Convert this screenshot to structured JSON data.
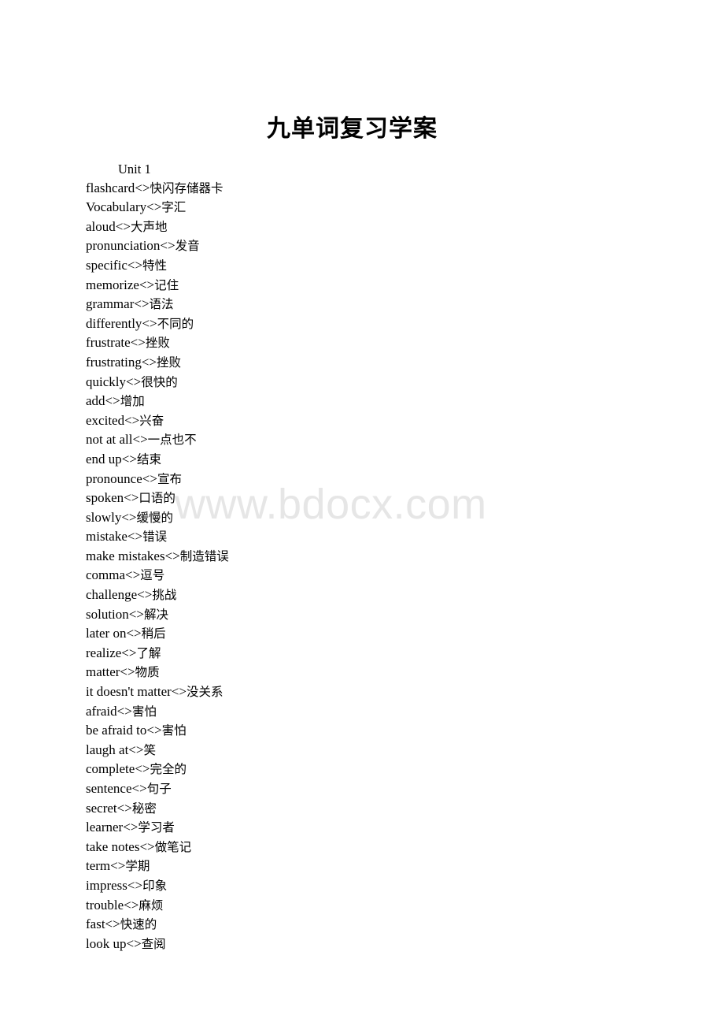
{
  "document": {
    "title": "九单词复习学案",
    "separator": "<>",
    "watermark": "www.bdocx.com",
    "watermark_color": "#e6e6e6",
    "text_color": "#000000",
    "page_background": "#ffffff"
  },
  "sections": [
    {
      "heading": "Unit 1",
      "entries": [
        {
          "term": "flashcard",
          "meaning": "快闪存储器卡"
        },
        {
          "term": "Vocabulary",
          "meaning": "字汇"
        },
        {
          "term": "aloud",
          "meaning": "大声地"
        },
        {
          "term": "pronunciation",
          "meaning": "发音"
        },
        {
          "term": "specific",
          "meaning": "特性"
        },
        {
          "term": "memorize",
          "meaning": "记住"
        },
        {
          "term": "grammar",
          "meaning": "语法"
        },
        {
          "term": "differently",
          "meaning": "不同的"
        },
        {
          "term": "frustrate",
          "meaning": "挫败"
        },
        {
          "term": "frustrating",
          "meaning": "挫败"
        },
        {
          "term": "quickly",
          "meaning": "很快的"
        },
        {
          "term": "add",
          "meaning": "增加"
        },
        {
          "term": "excited",
          "meaning": "兴奋"
        },
        {
          "term": "not at all",
          "meaning": "一点也不"
        },
        {
          "term": "end up",
          "meaning": "结束"
        },
        {
          "term": "pronounce",
          "meaning": "宣布"
        },
        {
          "term": "spoken",
          "meaning": "口语的"
        },
        {
          "term": "slowly",
          "meaning": "缓慢的"
        },
        {
          "term": "mistake",
          "meaning": "错误"
        },
        {
          "term": "make mistakes",
          "meaning": "制造错误"
        },
        {
          "term": "comma",
          "meaning": "逗号"
        },
        {
          "term": "challenge",
          "meaning": "挑战"
        },
        {
          "term": "solution",
          "meaning": "解决"
        },
        {
          "term": "later on",
          "meaning": "稍后"
        },
        {
          "term": "realize",
          "meaning": "了解"
        },
        {
          "term": "matter",
          "meaning": "物质"
        },
        {
          "term": "it doesn't matter",
          "meaning": "没关系"
        },
        {
          "term": "afraid",
          "meaning": "害怕"
        },
        {
          "term": "be afraid to",
          "meaning": "害怕"
        },
        {
          "term": "laugh at",
          "meaning": "笑"
        },
        {
          "term": "complete",
          "meaning": "完全的"
        },
        {
          "term": "sentence",
          "meaning": "句子"
        },
        {
          "term": "secret",
          "meaning": "秘密"
        },
        {
          "term": "learner",
          "meaning": "学习者"
        },
        {
          "term": "take notes",
          "meaning": "做笔记"
        },
        {
          "term": "term",
          "meaning": "学期"
        },
        {
          "term": "impress",
          "meaning": "印象"
        },
        {
          "term": "trouble",
          "meaning": "麻烦"
        },
        {
          "term": "fast",
          "meaning": "快速的"
        },
        {
          "term": "look up",
          "meaning": "查阅"
        }
      ]
    }
  ]
}
